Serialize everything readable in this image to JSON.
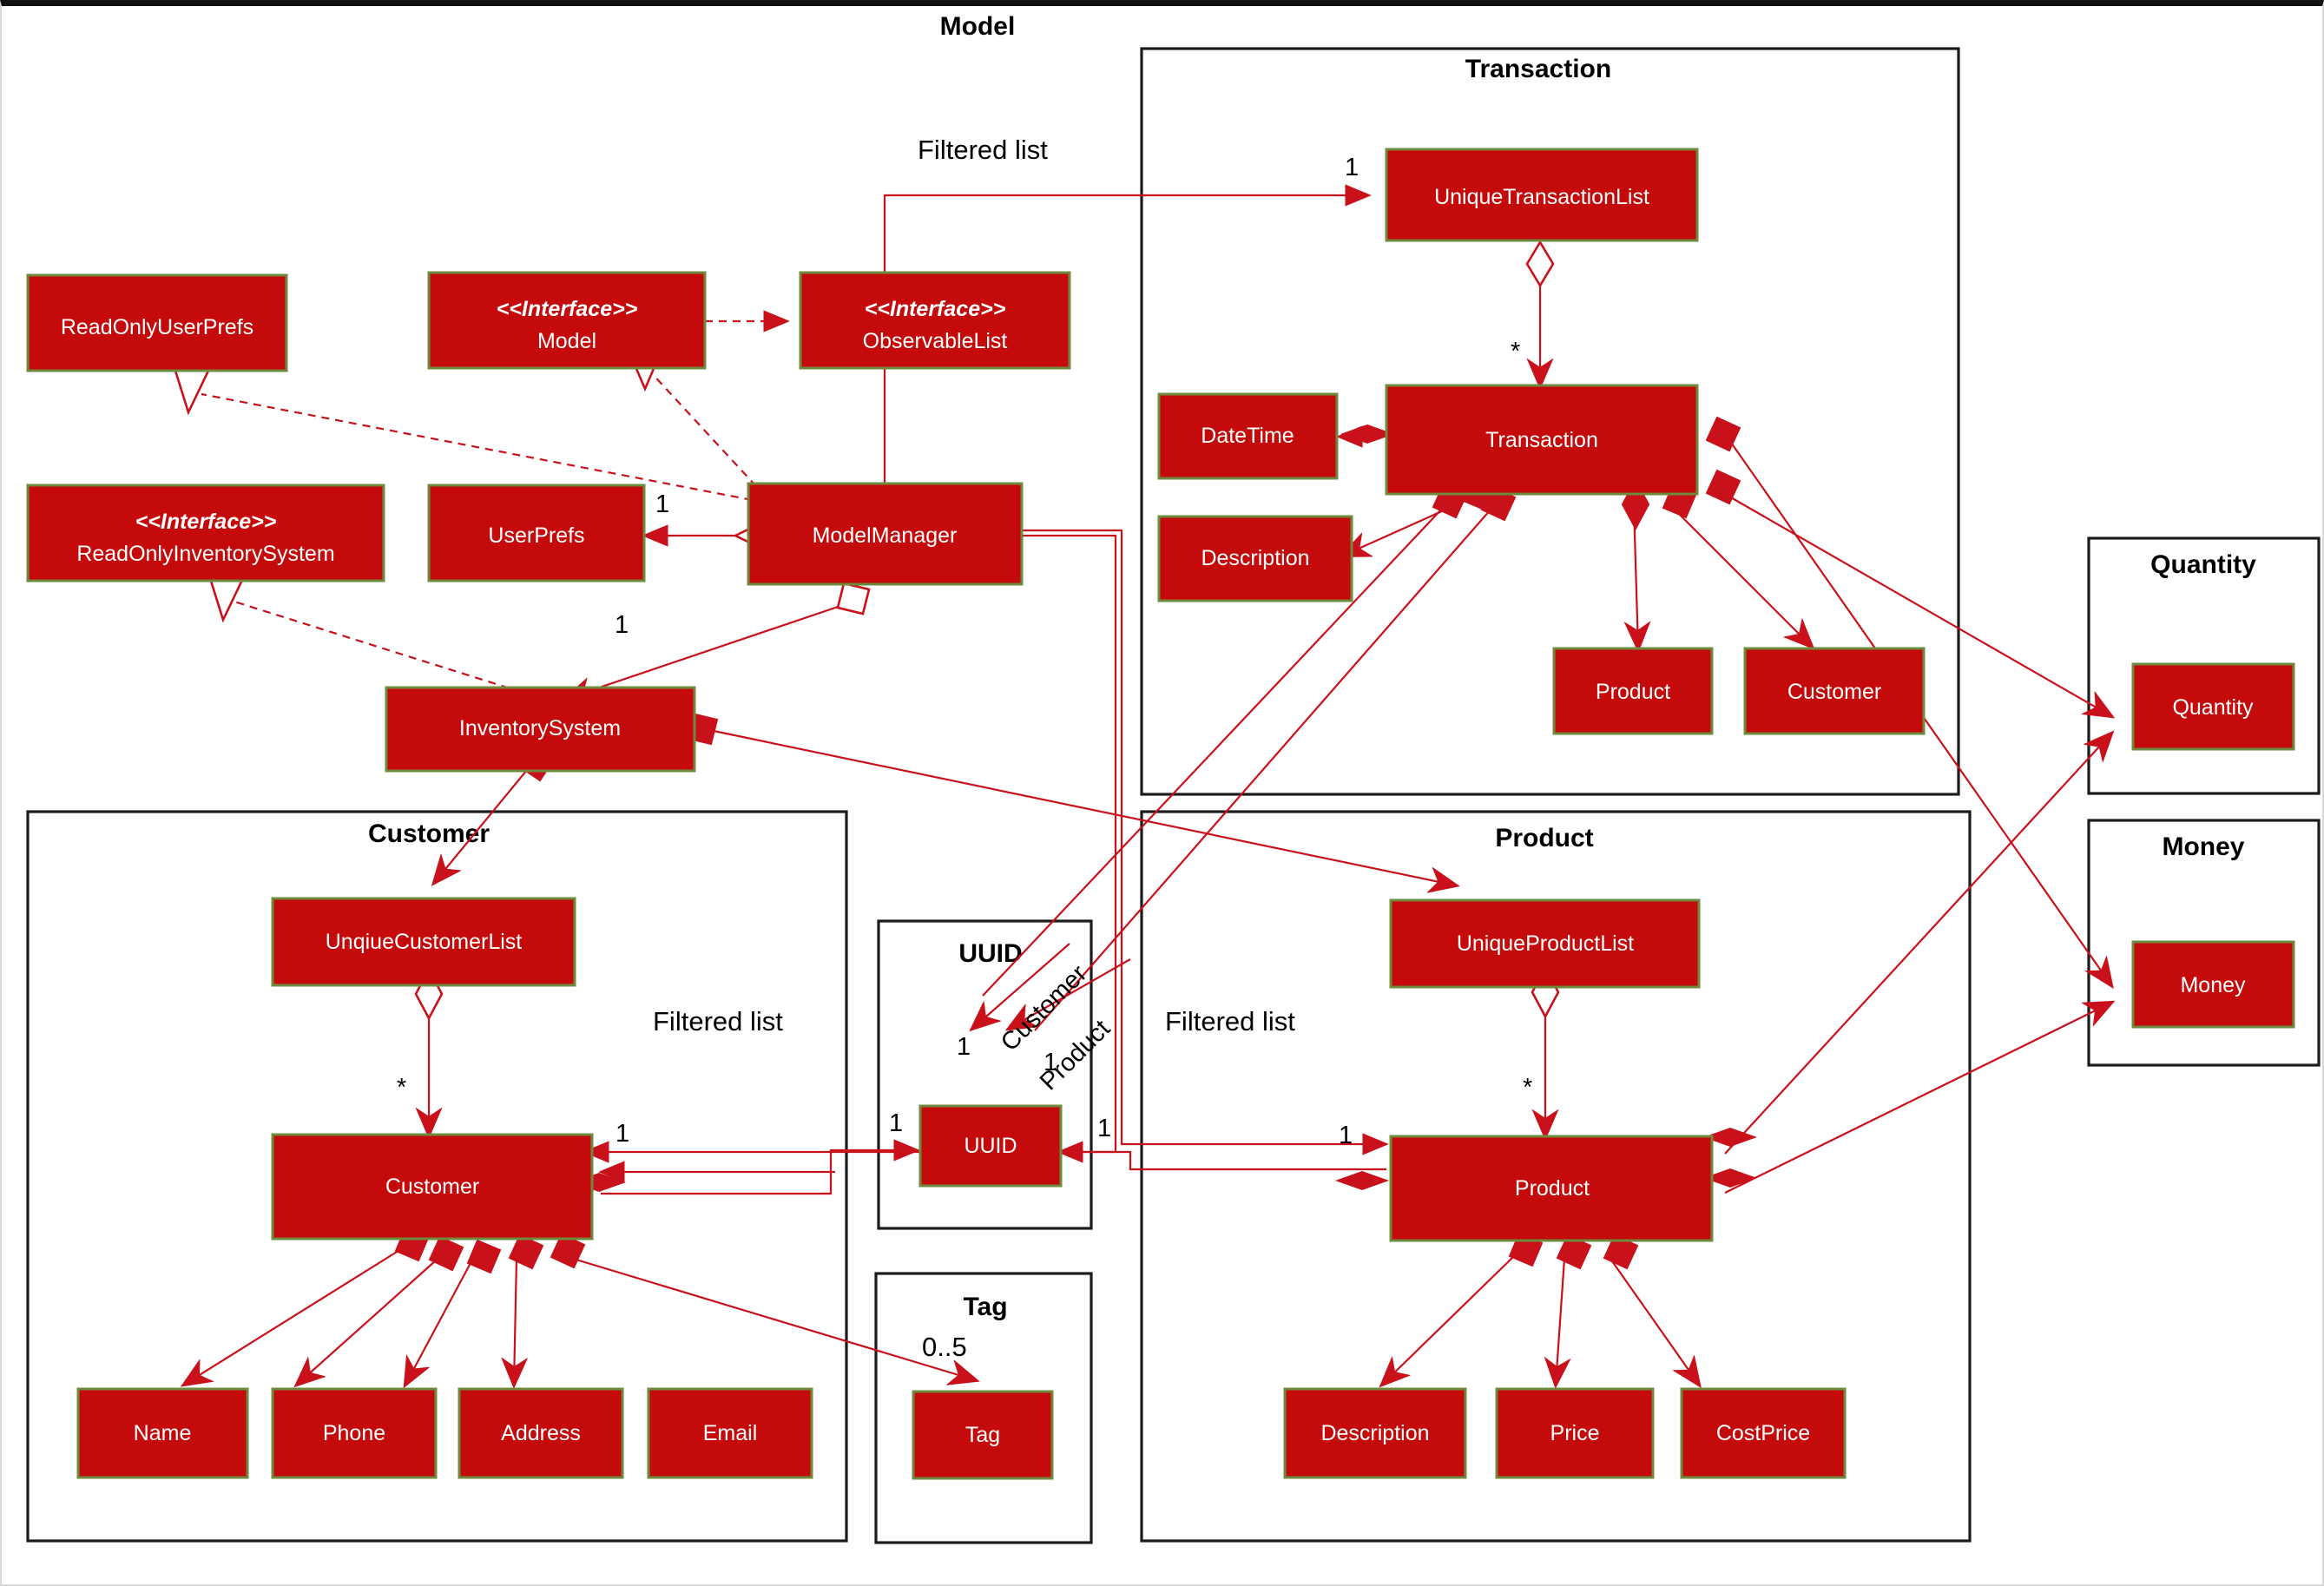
{
  "diagram": {
    "title": "Model",
    "accent_color": "#c40a0a",
    "border_color": "#6e8b3d",
    "line_color": "#c9111b",
    "package_border_color": "#1b1b1b"
  },
  "packages": [
    {
      "id": "transaction",
      "title": "Transaction"
    },
    {
      "id": "quantity",
      "title": "Quantity"
    },
    {
      "id": "money",
      "title": "Money"
    },
    {
      "id": "customer",
      "title": "Customer"
    },
    {
      "id": "uuid",
      "title": "UUID"
    },
    {
      "id": "tag",
      "title": "Tag"
    },
    {
      "id": "product",
      "title": "Product"
    }
  ],
  "classes": [
    {
      "id": "readonlyuserprefs",
      "name": "ReadOnlyUserPrefs",
      "stereotype": ""
    },
    {
      "id": "model",
      "name": "Model",
      "stereotype": "<<Interface>>"
    },
    {
      "id": "observablelist",
      "name": "ObservableList",
      "stereotype": "<<Interface>>"
    },
    {
      "id": "readonlyinventorysystem",
      "name": "ReadOnlyInventorySystem",
      "stereotype": "<<Interface>>"
    },
    {
      "id": "userprefs",
      "name": "UserPrefs",
      "stereotype": ""
    },
    {
      "id": "modelmanager",
      "name": "ModelManager",
      "stereotype": ""
    },
    {
      "id": "inventorysystem",
      "name": "InventorySystem",
      "stereotype": ""
    },
    {
      "id": "uniquetransactionlist",
      "name": "UniqueTransactionList",
      "stereotype": ""
    },
    {
      "id": "transaction",
      "name": "Transaction",
      "stereotype": ""
    },
    {
      "id": "datetime",
      "name": "DateTime",
      "stereotype": ""
    },
    {
      "id": "description_t",
      "name": "Description",
      "stereotype": ""
    },
    {
      "id": "product_t",
      "name": "Product",
      "stereotype": ""
    },
    {
      "id": "customer_t",
      "name": "Customer",
      "stereotype": ""
    },
    {
      "id": "quantity",
      "name": "Quantity",
      "stereotype": ""
    },
    {
      "id": "money",
      "name": "Money",
      "stereotype": ""
    },
    {
      "id": "unqiuecustomerlist",
      "name": "UnqiueCustomerList",
      "stereotype": ""
    },
    {
      "id": "customer",
      "name": "Customer",
      "stereotype": ""
    },
    {
      "id": "name",
      "name": "Name",
      "stereotype": ""
    },
    {
      "id": "phone",
      "name": "Phone",
      "stereotype": ""
    },
    {
      "id": "address",
      "name": "Address",
      "stereotype": ""
    },
    {
      "id": "email",
      "name": "Email",
      "stereotype": ""
    },
    {
      "id": "uuid",
      "name": "UUID",
      "stereotype": ""
    },
    {
      "id": "tag",
      "name": "Tag",
      "stereotype": ""
    },
    {
      "id": "uniqueproductlist",
      "name": "UniqueProductList",
      "stereotype": ""
    },
    {
      "id": "product",
      "name": "Product",
      "stereotype": ""
    },
    {
      "id": "description_p",
      "name": "Description",
      "stereotype": ""
    },
    {
      "id": "price",
      "name": "Price",
      "stereotype": ""
    },
    {
      "id": "costprice",
      "name": "CostPrice",
      "stereotype": ""
    }
  ],
  "annotations": {
    "filtered_list_top": "Filtered list",
    "filtered_list_customer": "Filtered list",
    "filtered_list_product": "Filtered list",
    "uuid_customer_role": "Customer",
    "uuid_product_role": "Product"
  },
  "multiplicities": {
    "txlist_in": "1",
    "txlist_tx": "*",
    "modelmanager_userprefs": "1",
    "modelmanager_inventorysystem": "1",
    "customerlist_customer": "*",
    "customer_one": "1",
    "customer_uuid_left": "1",
    "uuid_left": "1",
    "uuid_right": "1",
    "uuid_customer_mult": "1",
    "uuid_product_mult": "1",
    "productlist_product": "*",
    "product_one": "1",
    "tag_mult": "0..5"
  }
}
